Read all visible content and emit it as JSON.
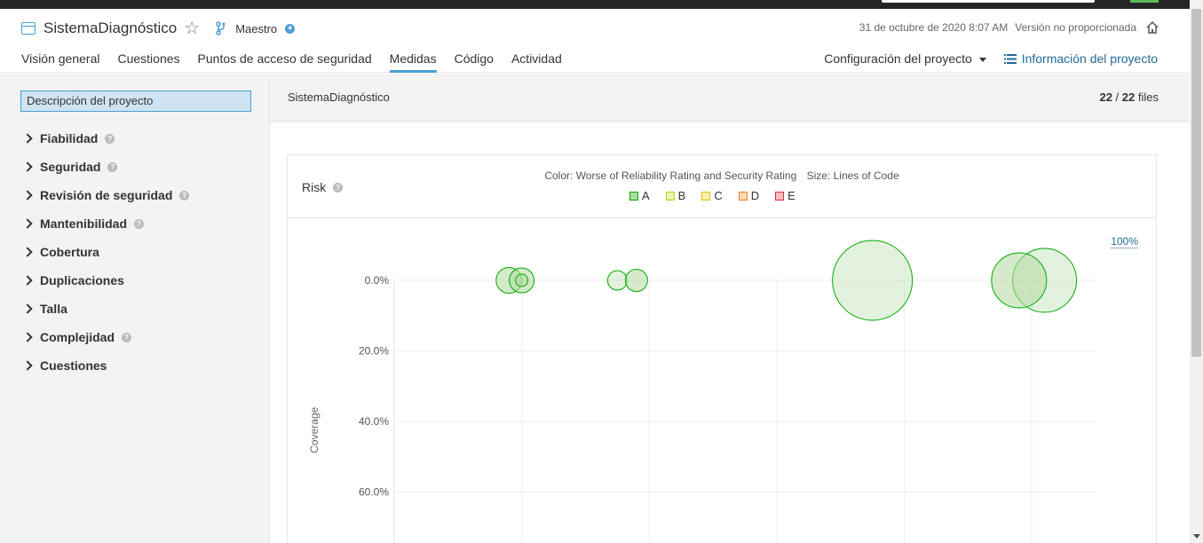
{
  "project": {
    "title": "SistemaDiagnóstico",
    "branch": "Maestro",
    "date": "31 de octubre de 2020 8:07 AM",
    "version": "Versión no proporcionada"
  },
  "nav": {
    "tabs": [
      {
        "label": "Visión general"
      },
      {
        "label": "Cuestiones"
      },
      {
        "label": "Puntos de acceso de seguridad"
      },
      {
        "label": "Medidas",
        "active": true
      },
      {
        "label": "Código"
      },
      {
        "label": "Actividad"
      }
    ],
    "config_label": "Configuración del proyecto",
    "info_label": "Información del proyecto"
  },
  "sidebar": {
    "overview": "Descripción del proyecto",
    "domains": [
      {
        "label": "Fiabilidad",
        "help": true
      },
      {
        "label": "Seguridad",
        "help": true
      },
      {
        "label": "Revisión de seguridad",
        "help": true
      },
      {
        "label": "Mantenibilidad",
        "help": true
      },
      {
        "label": "Cobertura",
        "help": false
      },
      {
        "label": "Duplicaciones",
        "help": false
      },
      {
        "label": "Talla",
        "help": false
      },
      {
        "label": "Complejidad",
        "help": true
      },
      {
        "label": "Cuestiones",
        "help": false
      }
    ]
  },
  "main": {
    "breadcrumb": "SistemaDiagnóstico",
    "files_current": "22",
    "files_total": "22",
    "files_label": "files"
  },
  "risk": {
    "title": "Risk",
    "color_caption": "Color: Worse of Reliability Rating and Security Rating",
    "size_caption": "Size: Lines of Code",
    "legend": [
      {
        "label": "A",
        "stroke": "#00aa00",
        "fill": "#b0d9a0"
      },
      {
        "label": "B",
        "stroke": "#b0d513",
        "fill": "#eaf3b5"
      },
      {
        "label": "C",
        "stroke": "#eabe06",
        "fill": "#faf0b5"
      },
      {
        "label": "D",
        "stroke": "#ed7d20",
        "fill": "#fbd9b9"
      },
      {
        "label": "E",
        "stroke": "#d4333f",
        "fill": "#f4c0c4"
      }
    ],
    "zoom_label": "100%"
  },
  "chart_data": {
    "type": "scatter",
    "ylabel": "Coverage",
    "ytick_labels": [
      "0.0%",
      "20.0%",
      "40.0%",
      "60.0%"
    ],
    "y_ticks": [
      0,
      20,
      40,
      60
    ],
    "ylim": [
      0,
      78
    ],
    "xlim": [
      0,
      5.5
    ],
    "x_gridlines": [
      1,
      2,
      3,
      4,
      5
    ],
    "points": [
      {
        "x": 0.9,
        "y": 0,
        "size": 29,
        "rating": "A",
        "opacity": 0.55
      },
      {
        "x": 1.0,
        "y": 0,
        "size": 28,
        "rating": "A",
        "opacity": 0.55
      },
      {
        "x": 1.0,
        "y": 0,
        "size": 14,
        "rating": "A",
        "opacity": 0.55
      },
      {
        "x": 1.75,
        "y": 0,
        "size": 22,
        "rating": "A",
        "opacity": 0.35
      },
      {
        "x": 1.9,
        "y": 0,
        "size": 25,
        "rating": "A",
        "opacity": 0.55
      },
      {
        "x": 3.75,
        "y": 0,
        "size": 90,
        "rating": "A",
        "opacity": 0.35
      },
      {
        "x": 5.1,
        "y": 0,
        "size": 72,
        "rating": "A",
        "opacity": 0.35
      },
      {
        "x": 4.9,
        "y": 0,
        "size": 62,
        "rating": "A",
        "opacity": 0.55
      }
    ]
  }
}
